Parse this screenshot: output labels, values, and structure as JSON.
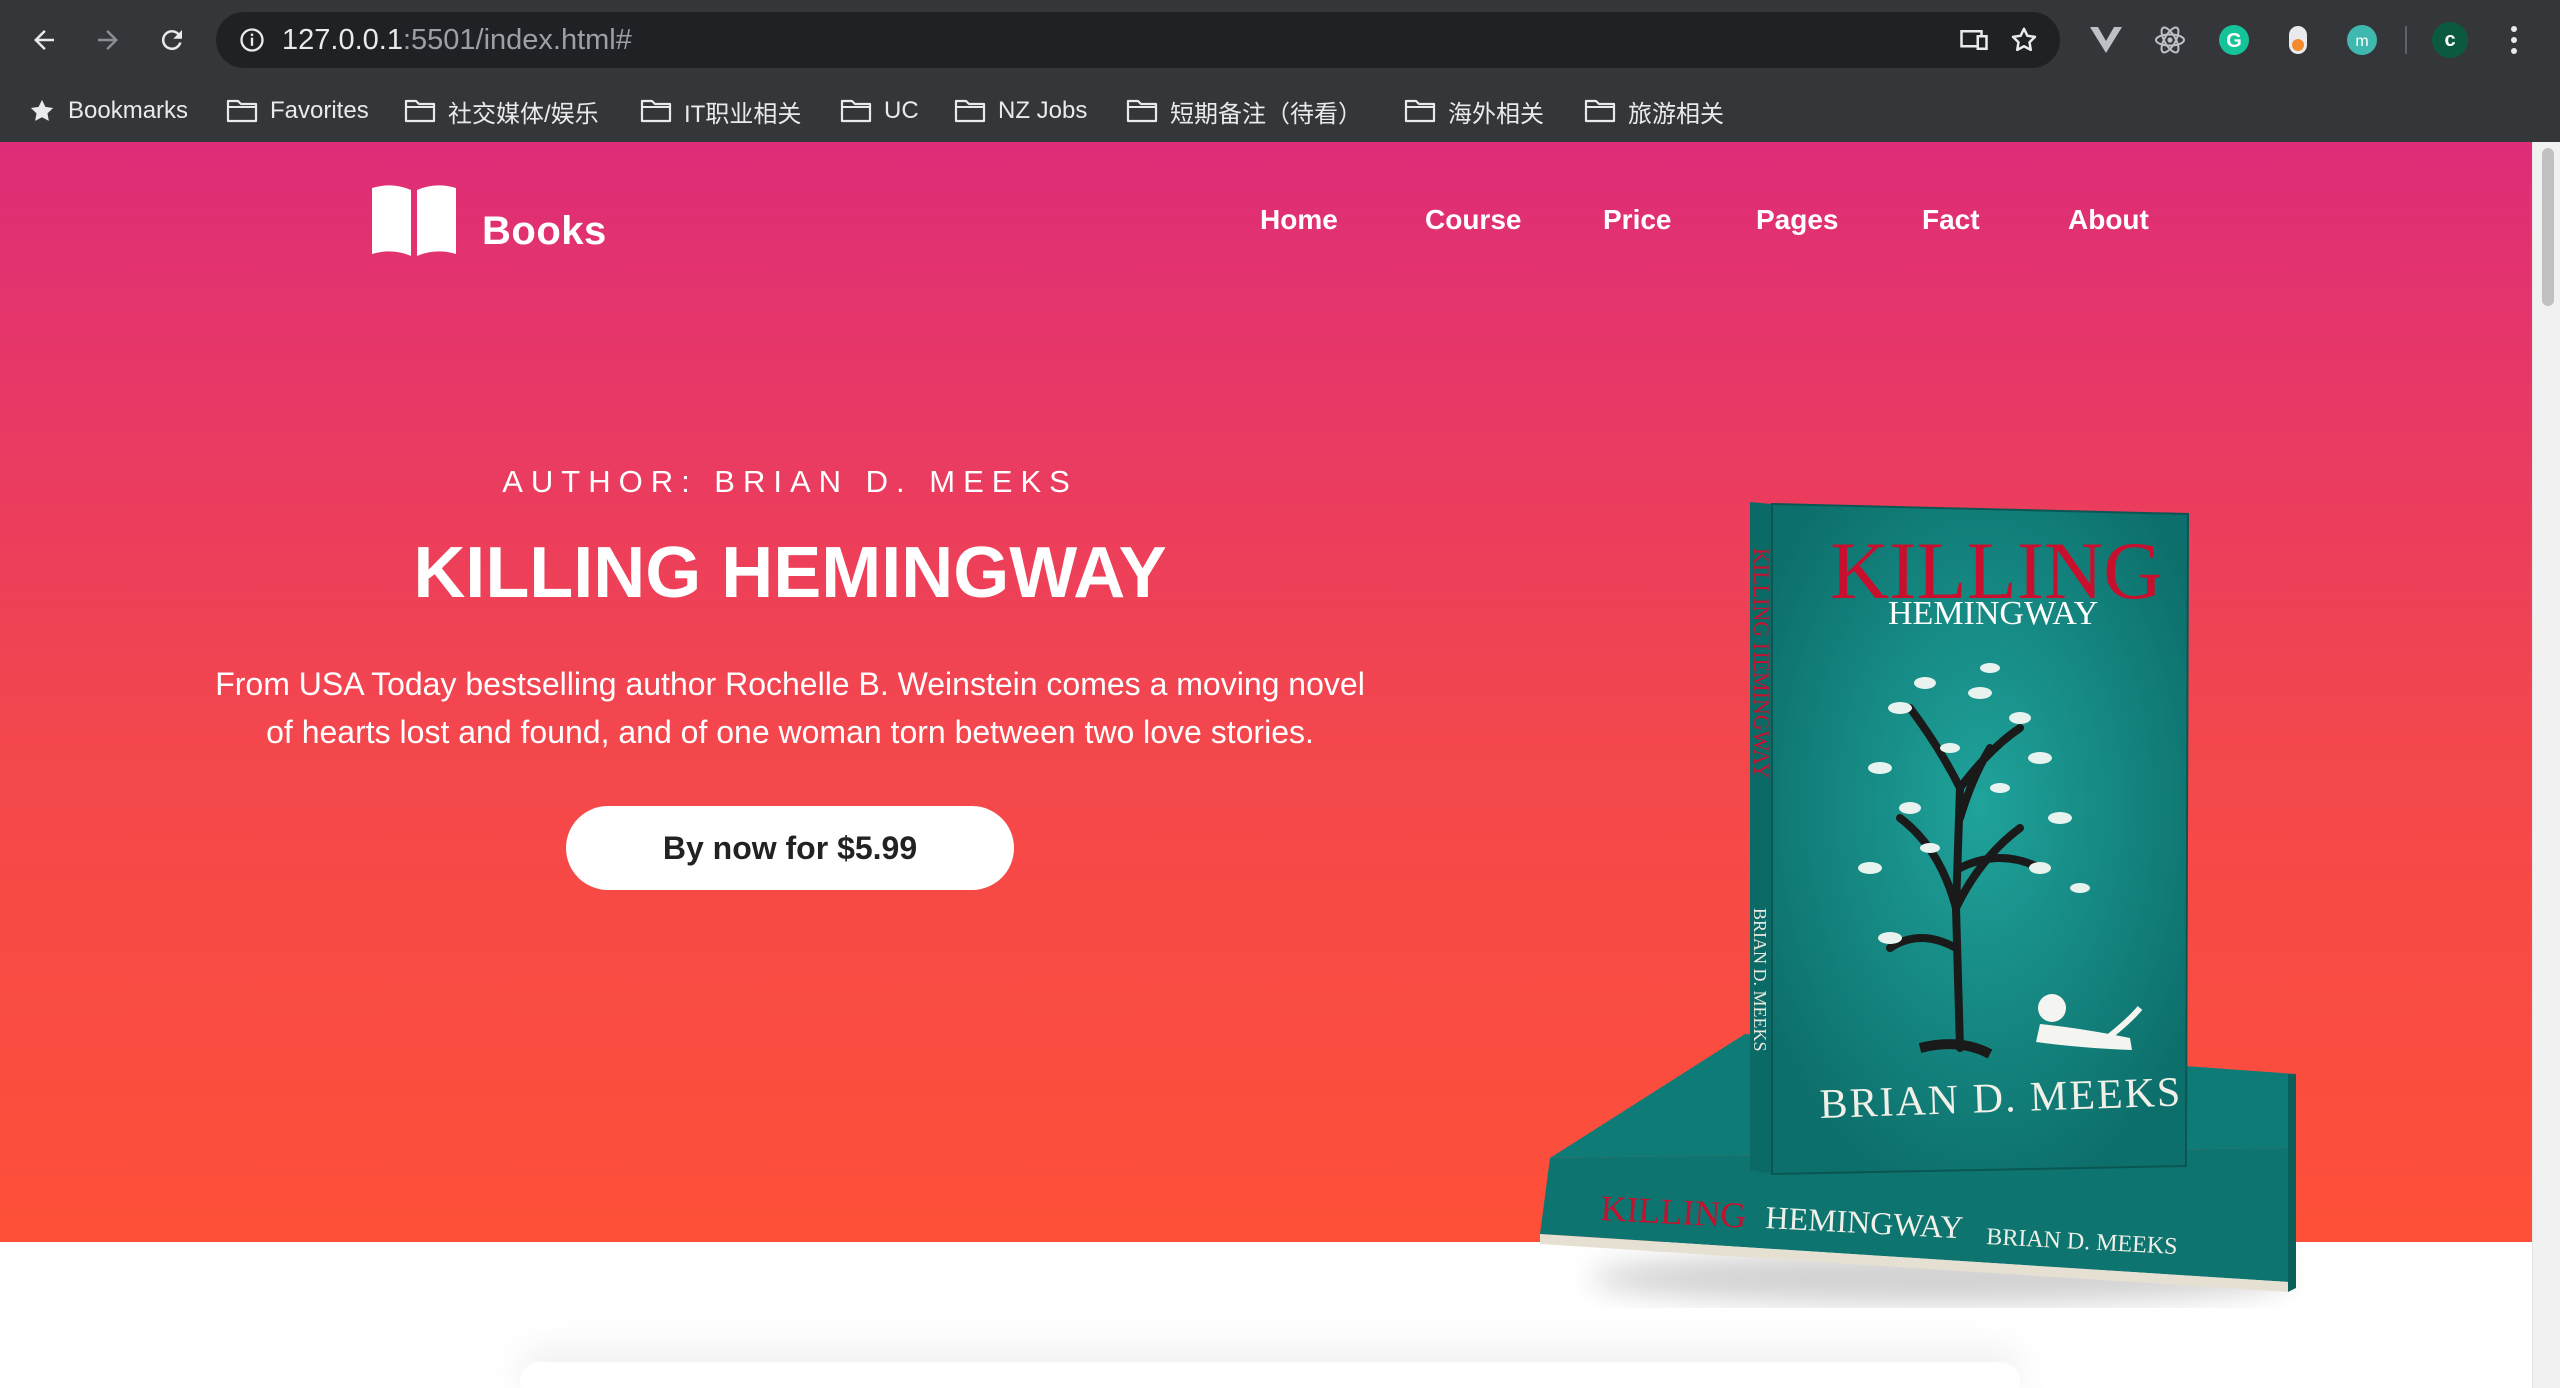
{
  "browser": {
    "url_host": "127.0.0.1",
    "url_rest": ":5501/index.html#",
    "profile_initial": "c"
  },
  "bookmarks": [
    {
      "label": "Bookmarks",
      "icon": "star-icon"
    },
    {
      "label": "Favorites",
      "icon": "folder-icon"
    },
    {
      "label": "社交媒体/娱乐",
      "icon": "folder-icon"
    },
    {
      "label": "IT职业相关",
      "icon": "folder-icon"
    },
    {
      "label": "UC",
      "icon": "folder-icon"
    },
    {
      "label": "NZ Jobs",
      "icon": "folder-icon"
    },
    {
      "label": "短期备注（待看）",
      "icon": "folder-icon"
    },
    {
      "label": "海外相关",
      "icon": "folder-icon"
    },
    {
      "label": "旅游相关",
      "icon": "folder-icon"
    }
  ],
  "site": {
    "logo_text": "Books",
    "nav": [
      "Home",
      "Course",
      "Price",
      "Pages",
      "Fact",
      "About"
    ]
  },
  "hero": {
    "author": "AUTHOR: BRIAN D. MEEKS",
    "title": "KILLING HEMINGWAY",
    "description_line1": "From USA Today bestselling author Rochelle B. Weinstein comes a moving novel",
    "description_line2": "of hearts lost and found, and of one woman torn between two love stories.",
    "buy_button": "By now for $5.99"
  },
  "book_cover": {
    "title_word1": "KILLING",
    "title_word2": "HEMINGWAY",
    "author": "BRIAN D. MEEKS",
    "spine_title": "KILLING HEMINGWAY",
    "spine_author": "BRIAN D. MEEKS"
  },
  "colors": {
    "gradient_top": "#de2d78",
    "gradient_bottom": "#fe5038",
    "book_teal": "#128a85",
    "title_red": "#c8102e"
  }
}
